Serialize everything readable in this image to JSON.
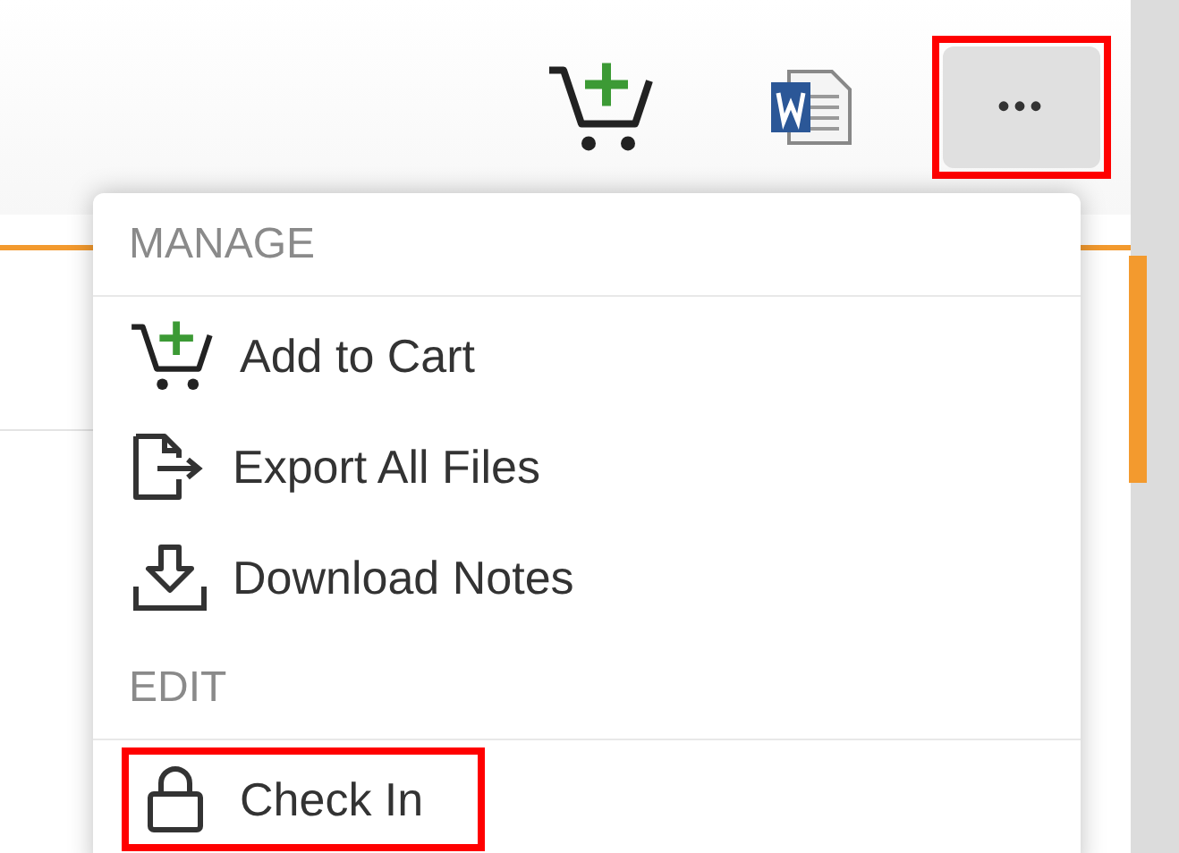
{
  "toolbar": {
    "more_button": {
      "label": "•••",
      "highlighted": true
    }
  },
  "menu": {
    "sections": [
      {
        "heading": "MANAGE",
        "items": [
          {
            "label": "Add to Cart",
            "kind": "cart",
            "highlighted": false
          },
          {
            "label": "Export All Files",
            "kind": "export",
            "highlighted": false
          },
          {
            "label": "Download Notes",
            "kind": "download",
            "highlighted": false
          }
        ]
      },
      {
        "heading": "EDIT",
        "items": [
          {
            "label": "Check In",
            "kind": "lock",
            "highlighted": true
          }
        ]
      }
    ]
  }
}
